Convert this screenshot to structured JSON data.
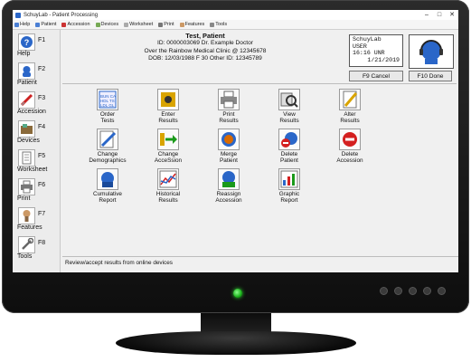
{
  "window": {
    "title": "SchuyLab - Patient Processing",
    "minimize": "–",
    "maximize": "□",
    "close": "✕"
  },
  "menubar": {
    "items": [
      {
        "label": "Help"
      },
      {
        "label": "Patient"
      },
      {
        "label": "Accession"
      },
      {
        "label": "Devices"
      },
      {
        "label": "Worksheet"
      },
      {
        "label": "Print"
      },
      {
        "label": "Features"
      },
      {
        "label": "Tools"
      }
    ]
  },
  "sidebar": {
    "items": [
      {
        "label": "Help",
        "fkey": "F1",
        "icon": "question-icon"
      },
      {
        "label": "Patient",
        "fkey": "F2",
        "icon": "patient-icon"
      },
      {
        "label": "Accession",
        "fkey": "F3",
        "icon": "syringe-icon"
      },
      {
        "label": "Devices",
        "fkey": "F4",
        "icon": "devices-icon"
      },
      {
        "label": "Worksheet",
        "fkey": "F5",
        "icon": "worksheet-icon"
      },
      {
        "label": "Print",
        "fkey": "F6",
        "icon": "printer-icon"
      },
      {
        "label": "Features",
        "fkey": "F7",
        "icon": "features-icon"
      },
      {
        "label": "Tools",
        "fkey": "F8",
        "icon": "tools-icon"
      }
    ]
  },
  "patient": {
    "name": "Test, Patient",
    "line1": "ID: 0000003069  Dr. Example Doctor",
    "line2": "Over the Rainbow Medical Clinic @ 12345678",
    "line3": "DOB: 12/03/1988  F 30    Other ID: 12345789"
  },
  "userbox": {
    "line1": "SchuyLab",
    "line2": "USER",
    "line3": "16:16 UNR",
    "line4": "1/21/2019"
  },
  "buttons": {
    "cancel": "F9 Cancel",
    "done": "F10 Done"
  },
  "grid": {
    "row1": [
      {
        "label": "Order\nTests",
        "icon": "order-tests-icon"
      },
      {
        "label": "Enter\nResults",
        "icon": "enter-results-icon"
      },
      {
        "label": "Print\nResults",
        "icon": "print-results-icon"
      },
      {
        "label": "View\nResults",
        "icon": "view-results-icon"
      },
      {
        "label": "Alter\nResults",
        "icon": "alter-results-icon"
      }
    ],
    "row2": [
      {
        "label": "Change\nDemographics",
        "icon": "change-demographics-icon"
      },
      {
        "label": "Change\nAcceSsion",
        "icon": "change-accession-icon"
      },
      {
        "label": "Merge\nPatient",
        "icon": "merge-patient-icon"
      },
      {
        "label": "Delete\nPatient",
        "icon": "delete-patient-icon"
      },
      {
        "label": "Delete\nAccession",
        "icon": "delete-accession-icon"
      }
    ],
    "row3": [
      {
        "label": "Cumulative\nReport",
        "icon": "cumulative-report-icon"
      },
      {
        "label": "Historical\nResults",
        "icon": "historical-results-icon"
      },
      {
        "label": "Reassign\nAccession",
        "icon": "reassign-accession-icon"
      },
      {
        "label": "Graphic\nReport",
        "icon": "graphic-report-icon"
      }
    ]
  },
  "status": {
    "text": "Review/accept results from online devices"
  },
  "colors": {
    "accent": "#2a66c8",
    "delete": "#d42020",
    "bezel": "#1a1a1a",
    "power_led": "#18b018"
  }
}
